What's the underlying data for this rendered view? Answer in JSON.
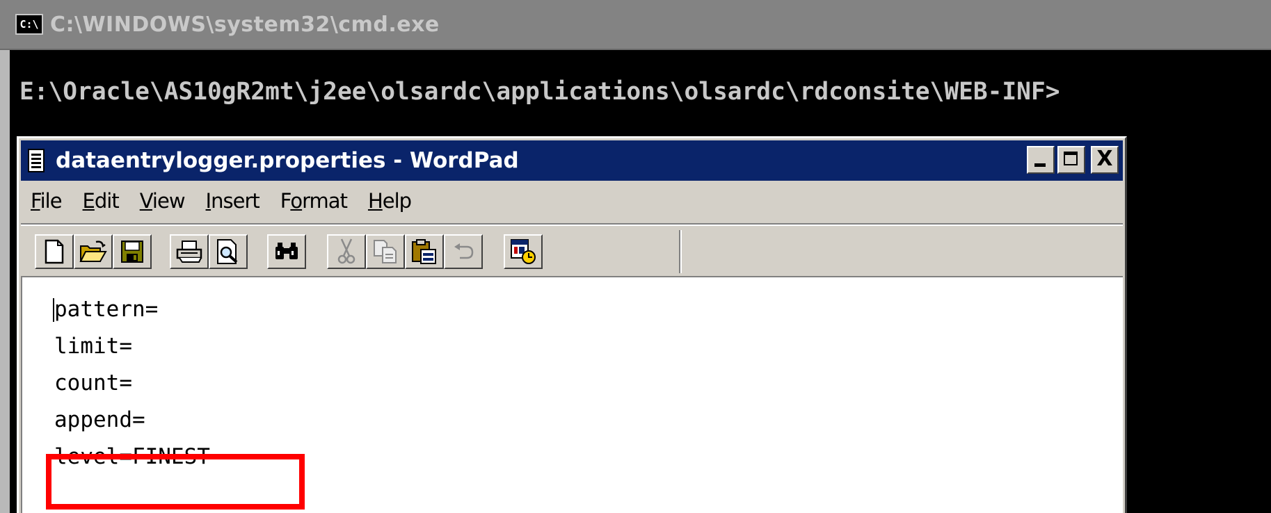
{
  "cmd": {
    "icon_text": "C:\\",
    "title": "C:\\WINDOWS\\system32\\cmd.exe",
    "prompt_line": "E:\\Oracle\\AS10gR2mt\\j2ee\\olsardc\\applications\\olsardc\\rdconsite\\WEB-INF>"
  },
  "wordpad": {
    "title": "dataentrylogger.properties - WordPad",
    "window_controls": {
      "close": "X"
    },
    "menu": [
      {
        "acc": "F",
        "rest": "ile"
      },
      {
        "acc": "E",
        "rest": "dit"
      },
      {
        "acc": "V",
        "rest": "iew"
      },
      {
        "acc": "I",
        "rest": "nsert"
      },
      {
        "pre": "F",
        "acc": "o",
        "rest": "rmat"
      },
      {
        "acc": "H",
        "rest": "elp"
      }
    ],
    "toolbar": {
      "buttons": [
        {
          "name": "new-button",
          "icon": "new-document-icon"
        },
        {
          "name": "open-button",
          "icon": "open-folder-icon"
        },
        {
          "name": "save-button",
          "icon": "save-disk-icon"
        },
        {
          "name": "print-button",
          "icon": "printer-icon"
        },
        {
          "name": "print-preview-button",
          "icon": "print-preview-icon"
        },
        {
          "name": "find-button",
          "icon": "binoculars-icon"
        },
        {
          "name": "cut-button",
          "icon": "scissors-icon",
          "disabled": true
        },
        {
          "name": "copy-button",
          "icon": "copy-icon",
          "disabled": true
        },
        {
          "name": "paste-button",
          "icon": "paste-icon"
        },
        {
          "name": "undo-button",
          "icon": "undo-icon",
          "disabled": true
        },
        {
          "name": "date-time-button",
          "icon": "date-time-icon"
        }
      ]
    },
    "document": {
      "lines": [
        "pattern=",
        "limit=",
        "count=",
        "append=",
        "level=FINEST"
      ]
    }
  },
  "colors": {
    "cmd_title_bg": "#838383",
    "wordpad_title_bg": "#0a246a",
    "highlight": "#ff0000"
  }
}
